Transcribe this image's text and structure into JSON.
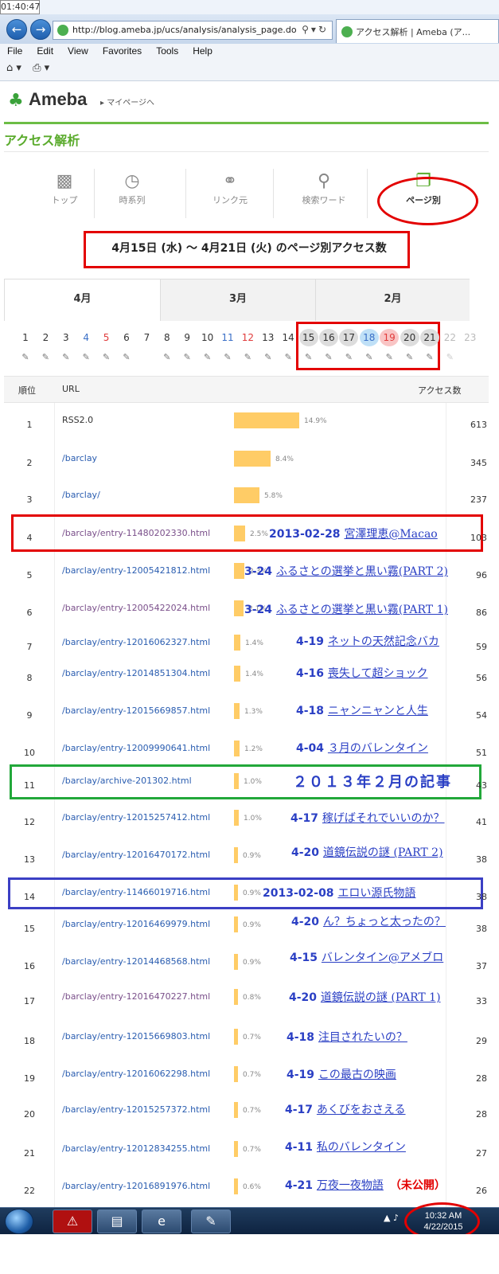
{
  "browser": {
    "clock": "01:40:47",
    "url": "http://blog.ameba.jp/ucs/analysis/analysis_page.do",
    "tab_title": "アクセス解析 | Ameba (ア...",
    "menu": [
      "File",
      "Edit",
      "View",
      "Favorites",
      "Tools",
      "Help"
    ]
  },
  "header": {
    "logo": "Ameba",
    "mypage_link": "▸ マイページへ",
    "page_title": "アクセス解析"
  },
  "nav": [
    {
      "label": "トップ",
      "icon": "bar-chart-icon"
    },
    {
      "label": "時系列",
      "icon": "clock-icon"
    },
    {
      "label": "リンク元",
      "icon": "link-icon"
    },
    {
      "label": "検索ワード",
      "icon": "search-icon"
    },
    {
      "label": "ページ別",
      "icon": "pages-icon"
    }
  ],
  "range_text": "4月15日 (水) 〜 4月21日 (火) のページ別アクセス数",
  "months": [
    "4月",
    "3月",
    "2月"
  ],
  "days": [
    "1",
    "2",
    "3",
    "4",
    "5",
    "6",
    "7",
    "8",
    "9",
    "10",
    "11",
    "12",
    "13",
    "14",
    "15",
    "16",
    "17",
    "18",
    "19",
    "20",
    "21",
    "22",
    "23"
  ],
  "table": {
    "headers": {
      "rank": "順位",
      "url": "URL",
      "count": "アクセス数"
    },
    "rows": [
      {
        "rank": "1",
        "url": "RSS2.0",
        "pct": "14.9%",
        "count": "613",
        "share": 14.9
      },
      {
        "rank": "2",
        "url": "/barclay",
        "pct": "8.4%",
        "count": "345",
        "share": 8.4
      },
      {
        "rank": "3",
        "url": "/barclay/",
        "pct": "5.8%",
        "count": "237",
        "share": 5.8
      },
      {
        "rank": "4",
        "url": "/barclay/entry-11480202330.html",
        "pct": "2.5%",
        "count": "103",
        "share": 2.5
      },
      {
        "rank": "5",
        "url": "/barclay/entry-12005421812.html",
        "pct": "2.3%",
        "count": "96",
        "share": 2.3
      },
      {
        "rank": "6",
        "url": "/barclay/entry-12005422024.html",
        "pct": "2.1%",
        "count": "86",
        "share": 2.1
      },
      {
        "rank": "7",
        "url": "/barclay/entry-12016062327.html",
        "pct": "1.4%",
        "count": "59",
        "share": 1.4
      },
      {
        "rank": "8",
        "url": "/barclay/entry-12014851304.html",
        "pct": "1.4%",
        "count": "56",
        "share": 1.4
      },
      {
        "rank": "9",
        "url": "/barclay/entry-12015669857.html",
        "pct": "1.3%",
        "count": "54",
        "share": 1.3
      },
      {
        "rank": "10",
        "url": "/barclay/entry-12009990641.html",
        "pct": "1.2%",
        "count": "51",
        "share": 1.2
      },
      {
        "rank": "11",
        "url": "/barclay/archive-201302.html",
        "pct": "1.0%",
        "count": "43",
        "share": 1.0
      },
      {
        "rank": "12",
        "url": "/barclay/entry-12015257412.html",
        "pct": "1.0%",
        "count": "41",
        "share": 1.0
      },
      {
        "rank": "13",
        "url": "/barclay/entry-12016470172.html",
        "pct": "0.9%",
        "count": "38",
        "share": 0.9
      },
      {
        "rank": "14",
        "url": "/barclay/entry-11466019716.html",
        "pct": "0.9%",
        "count": "38",
        "share": 0.9
      },
      {
        "rank": "15",
        "url": "/barclay/entry-12016469979.html",
        "pct": "0.9%",
        "count": "38",
        "share": 0.9
      },
      {
        "rank": "16",
        "url": "/barclay/entry-12014468568.html",
        "pct": "0.9%",
        "count": "37",
        "share": 0.9
      },
      {
        "rank": "17",
        "url": "/barclay/entry-12016470227.html",
        "pct": "0.8%",
        "count": "33",
        "share": 0.8
      },
      {
        "rank": "18",
        "url": "/barclay/entry-12015669803.html",
        "pct": "0.7%",
        "count": "29",
        "share": 0.7
      },
      {
        "rank": "19",
        "url": "/barclay/entry-12016062298.html",
        "pct": "0.7%",
        "count": "28",
        "share": 0.7
      },
      {
        "rank": "20",
        "url": "/barclay/entry-12015257372.html",
        "pct": "0.7%",
        "count": "28",
        "share": 0.7
      },
      {
        "rank": "21",
        "url": "/barclay/entry-12012834255.html",
        "pct": "0.7%",
        "count": "27",
        "share": 0.7
      },
      {
        "rank": "22",
        "url": "/barclay/entry-12016891976.html",
        "pct": "0.6%",
        "count": "26",
        "share": 0.6
      }
    ]
  },
  "annotations": {
    "r4": {
      "date": "2013-02-28",
      "title": "宮澤理恵@Macao"
    },
    "r5": {
      "date": "3-24",
      "title": "ふるさとの選挙と黒い霧(PART 2)"
    },
    "r6": {
      "date": "3-24",
      "title": "ふるさとの選挙と黒い霧(PART 1)"
    },
    "r7": {
      "date": "4-19",
      "title": "ネットの天然記念バカ"
    },
    "r8": {
      "date": "4-16",
      "title": "喪失して超ショック"
    },
    "r9": {
      "date": "4-18",
      "title": "ニャンニャンと人生"
    },
    "r10": {
      "date": "4-04",
      "title": "３月のバレンタイン"
    },
    "r11": {
      "date": "",
      "title": "２０１３年２月の記事"
    },
    "r12": {
      "date": "4-17",
      "title": "稼げばそれでいいのか？"
    },
    "r13": {
      "date": "4-20",
      "title": "道鏡伝説の謎 (PART 2)"
    },
    "r14": {
      "date": "2013-02-08",
      "title": "エロい源氏物語"
    },
    "r15": {
      "date": "4-20",
      "title": "ん？ちょっと太ったの？"
    },
    "r16": {
      "date": "4-15",
      "title": "バレンタイン@アメブロ"
    },
    "r17": {
      "date": "4-20",
      "title": "道鏡伝説の謎 (PART 1)"
    },
    "r18": {
      "date": "4-18",
      "title": "注目されたいの？"
    },
    "r19": {
      "date": "4-19",
      "title": "この最古の映画"
    },
    "r20": {
      "date": "4-17",
      "title": "あくびをおさえる"
    },
    "r21": {
      "date": "4-11",
      "title": "私のバレンタイン"
    },
    "r22": {
      "date": "4-21",
      "title": "万夜一夜物語",
      "note": "（未公開）"
    }
  },
  "taskbar": {
    "time": "10:32 AM",
    "date": "4/22/2015"
  },
  "colors": {
    "red": "#e30000",
    "green": "#22a83a",
    "blue": "#3b3fc4",
    "bar": "#ffcc66",
    "accent": "#5aab2c"
  }
}
